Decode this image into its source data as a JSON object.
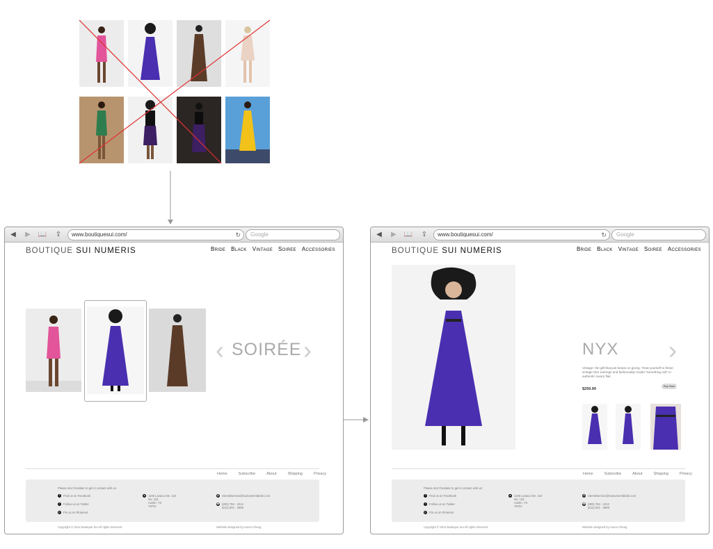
{
  "colors": {
    "pink_dress": "#e2559a",
    "purple_dress": "#4a2fb0",
    "bronze_dress": "#5a3b28",
    "cream_dress": "#ead2c4",
    "green_dress": "#2e7d4f",
    "dark_purple_dress": "#3d1f63",
    "yellow_dress": "#f2c21a",
    "cross_red": "#e03030",
    "arrow_gray": "#999999"
  },
  "grid": {
    "photos": [
      "pink-dress",
      "purple-dress",
      "bronze-gown",
      "cream-dress",
      "green-dress",
      "black-purple-dress",
      "dark-purple-dress",
      "yellow-dress"
    ]
  },
  "browser": {
    "url": "www.boutiquesui.com/",
    "search_placeholder": "Google"
  },
  "site": {
    "logo_light": "BOUTIQUE",
    "logo_bold": "SUI NUMERIS",
    "nav": [
      "Bride",
      "Black",
      "Vintage",
      "Soiree",
      "Accessories"
    ]
  },
  "category_page": {
    "title": "SOIRÉE",
    "prev": "‹",
    "next": "›"
  },
  "product_page": {
    "name": "NYX",
    "next": "›",
    "description": "Vintage- the gift that just keeps on giving. Treat yourself to these vintage Dior earrings and fashionably model \"something old\" in authentic luxury flair.",
    "price": "$259.99",
    "buy_label": "Buy Now"
  },
  "footer": {
    "links": [
      "Home",
      "Subscribe",
      "About",
      "Shipping",
      "Privacy"
    ],
    "intro": "Please don't hesitate to get in contact with us:",
    "social": [
      "Find us on Facebook",
      "Follow us on Twitter",
      "Pin us on Pinterest"
    ],
    "address": [
      "1106 Lavaca Ste. 110",
      "No. 118",
      "Austin, TX",
      "78701"
    ],
    "email": "clientelservice@suinumerisbride.com",
    "phone": [
      "(800) 784 - 2312",
      "(512) 601 - 3669"
    ],
    "copyright": "Copyright © 2012 Boutique Sui All rights reserved",
    "designer": "Website designed by  Aaron Cheng"
  }
}
